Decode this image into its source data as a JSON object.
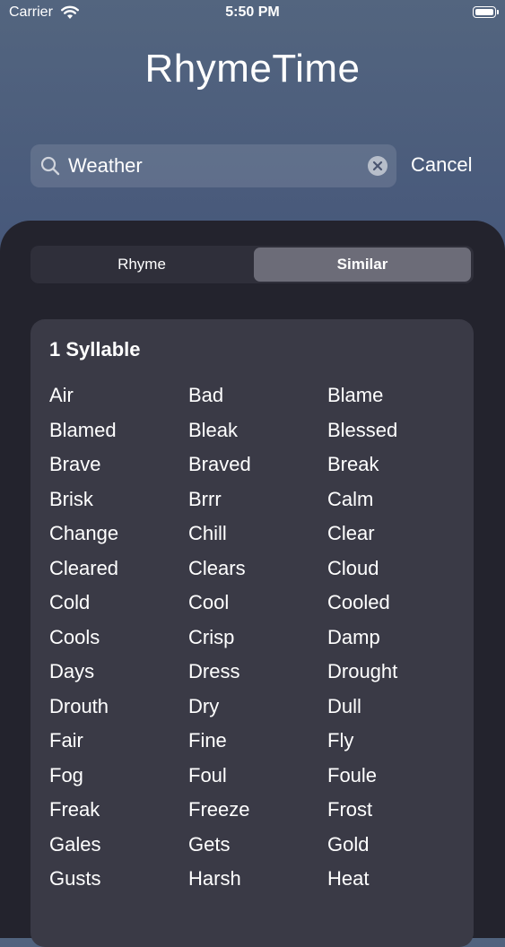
{
  "status_bar": {
    "carrier": "Carrier",
    "time": "5:50 PM"
  },
  "app": {
    "title": "RhymeTime"
  },
  "search": {
    "value": "Weather",
    "cancel_label": "Cancel"
  },
  "segments": {
    "rhyme_label": "Rhyme",
    "similar_label": "Similar",
    "selected": "Similar"
  },
  "results": {
    "heading": "1 Syllable",
    "words": [
      "Air",
      "Bad",
      "Blame",
      "Blamed",
      "Bleak",
      "Blessed",
      "Brave",
      "Braved",
      "Break",
      "Brisk",
      "Brrr",
      "Calm",
      "Change",
      "Chill",
      "Clear",
      "Cleared",
      "Clears",
      "Cloud",
      "Cold",
      "Cool",
      "Cooled",
      "Cools",
      "Crisp",
      "Damp",
      "Days",
      "Dress",
      "Drought",
      "Drouth",
      "Dry",
      "Dull",
      "Fair",
      "Fine",
      "Fly",
      "Fog",
      "Foul",
      "Foule",
      "Freak",
      "Freeze",
      "Frost",
      "Gales",
      "Gets",
      "Gold",
      "Gusts",
      "Harsh",
      "Heat"
    ]
  },
  "icons": {
    "wifi": "wifi-icon",
    "battery": "battery-icon",
    "search": "search-icon",
    "clear": "clear-icon"
  }
}
